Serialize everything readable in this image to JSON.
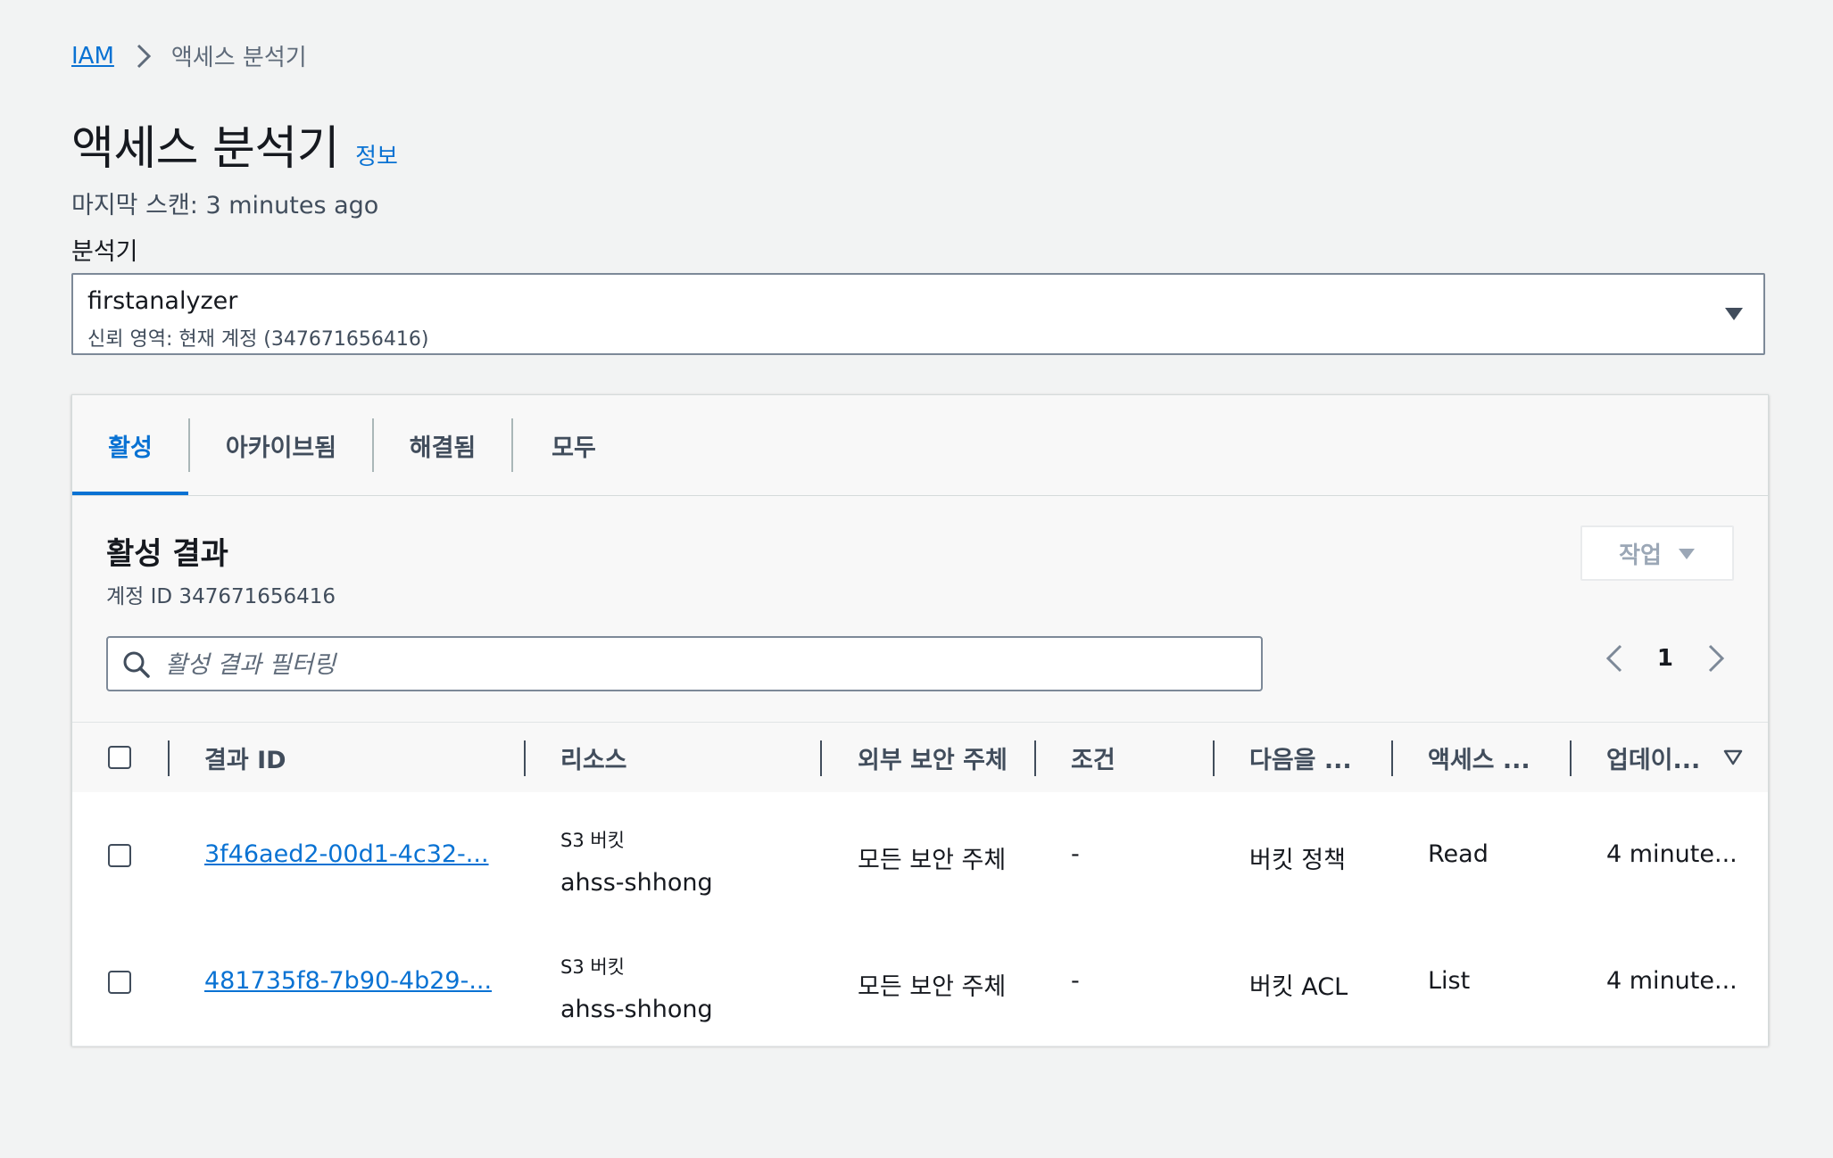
{
  "breadcrumb": {
    "root": "IAM",
    "current": "액세스 분석기"
  },
  "header": {
    "title": "액세스 분석기",
    "info": "정보",
    "last_scan": "마지막 스캔: 3 minutes ago",
    "analyzer_label": "분석기"
  },
  "analyzer_select": {
    "name": "firstanalyzer",
    "description": "신뢰 영역: 현재 계정 (347671656416)"
  },
  "tabs": [
    {
      "label": "활성",
      "active": true
    },
    {
      "label": "아카이브됨",
      "active": false
    },
    {
      "label": "해결됨",
      "active": false
    },
    {
      "label": "모두",
      "active": false
    }
  ],
  "panel": {
    "title": "활성 결과",
    "subtitle": "계정 ID 347671656416",
    "action_label": "작업",
    "search_placeholder": "활성 결과 필터링",
    "page": "1"
  },
  "table": {
    "columns": [
      "결과 ID",
      "리소스",
      "외부 보안 주체",
      "조건",
      "다음을 ...",
      "액세스 ...",
      "업데이..."
    ],
    "rows": [
      {
        "id": "3f46aed2-00d1-4c32-...",
        "resource_type": "S3 버킷",
        "resource_name": "ahss-shhong",
        "principal": "모든 보안 주체",
        "condition": "-",
        "shared_via": "버킷 정책",
        "access": "Read",
        "updated": "4 minute..."
      },
      {
        "id": "481735f8-7b90-4b29-...",
        "resource_type": "S3 버킷",
        "resource_name": "ahss-shhong",
        "principal": "모든 보안 주체",
        "condition": "-",
        "shared_via": "버킷 ACL",
        "access": "List",
        "updated": "4 minute..."
      }
    ]
  },
  "colors": {
    "link": "#0972d3",
    "text": "#16191f",
    "muted": "#414d5c",
    "background": "#f2f3f3"
  }
}
